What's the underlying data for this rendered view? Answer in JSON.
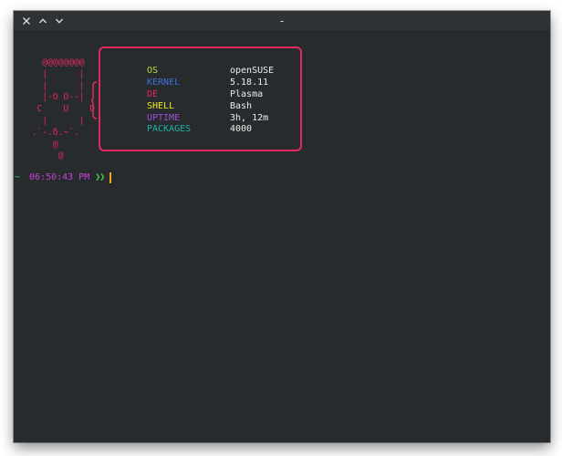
{
  "window": {
    "title": "-",
    "buttons": {
      "close_icon": "close-icon",
      "minimize_icon": "chevron-up-icon",
      "maximize_icon": "chevron-down-icon"
    }
  },
  "ascii_logo": "   @@@@@@@@\n   |      |\n   |      |\n   |-O O--|\n  C    U    D\n   |      |\n .`-.δ.~`.\n     @\n      @",
  "info": [
    {
      "key": "OS",
      "value": "openSUSE",
      "color": "#c1d94a"
    },
    {
      "key": "KERNEL",
      "value": "5.18.11",
      "color": "#3d6fd6"
    },
    {
      "key": "DE",
      "value": "Plasma",
      "color": "#e2295f"
    },
    {
      "key": "SHELL",
      "value": "Bash",
      "color": "#ecec20"
    },
    {
      "key": "UPTIME",
      "value": "3h, 12m",
      "color": "#9b4fd3"
    },
    {
      "key": "PACKAGES",
      "value": "4000",
      "color": "#20b2a6"
    }
  ],
  "prompt": {
    "tilde": "~",
    "time": "06:50:43 PM",
    "arrows": "❯❯"
  },
  "colors": {
    "background": "#282b2d",
    "accent": "#e2295f",
    "cursor": "#f2a31b"
  }
}
